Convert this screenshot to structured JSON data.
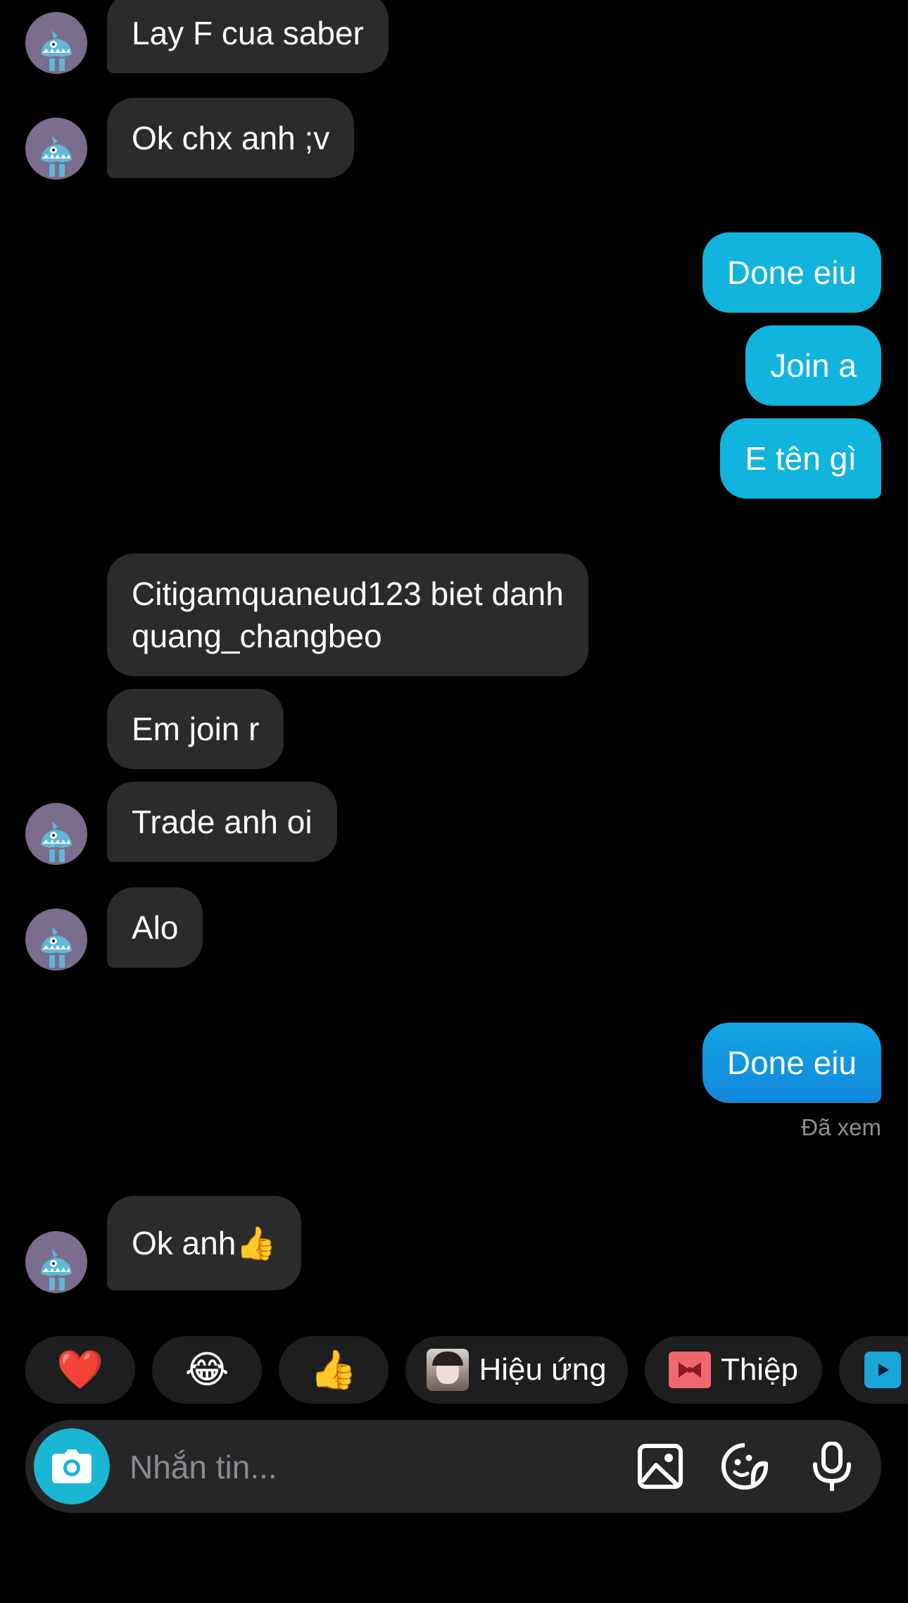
{
  "messages": [
    {
      "side": "in",
      "text": "Lay F cua saber"
    },
    {
      "side": "in",
      "text": "Ok chx anh ;v"
    },
    {
      "side": "out",
      "text": "Done eiu"
    },
    {
      "side": "out",
      "text": "Join a"
    },
    {
      "side": "out",
      "text": "E tên gì"
    },
    {
      "side": "in",
      "text_lines": [
        "Citigamquaneud123 biet danh",
        "quang_changbeo"
      ]
    },
    {
      "side": "in",
      "text": "Em join r"
    },
    {
      "side": "in",
      "text": "Trade anh oi"
    },
    {
      "side": "in",
      "text": "Alo"
    },
    {
      "side": "out",
      "text": "Done eiu"
    },
    {
      "side": "in",
      "text": "Ok anh👍"
    }
  ],
  "seen_status": "Đã xem",
  "quick_replies": {
    "heart": "❤️",
    "laugh": "😂",
    "thumbs": "👍",
    "effects_label": "Hiệu ứng",
    "card_label": "Thiệp"
  },
  "composer": {
    "placeholder": "Nhắn tin..."
  },
  "colors": {
    "background": "#000000",
    "incoming_bubble": "#2b2b2d",
    "outgoing_bubble": "#11b4dc",
    "outgoing_bubble_last": "#1287db",
    "camera_button": "#1ab6d3",
    "avatar": "#7b6d8d"
  },
  "icons": {
    "avatar": "blue-monster-avatar",
    "camera": "camera-icon",
    "gallery": "image-icon",
    "sticker": "sticker-icon",
    "mic": "microphone-icon",
    "effects": "effect-thumbnail-icon",
    "card": "gift-card-icon",
    "more": "play-icon"
  }
}
